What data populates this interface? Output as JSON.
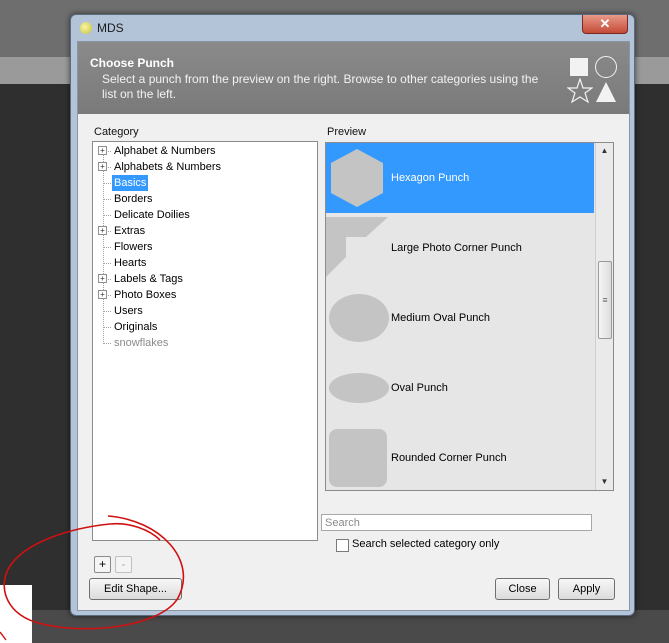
{
  "window": {
    "title": "MDS",
    "close_symbol": "✕"
  },
  "header": {
    "title": "Choose Punch",
    "description": "Select a punch from the preview on the right. Browse to other categories using the list on the left."
  },
  "category": {
    "label": "Category",
    "items": [
      {
        "label": "Alphabet & Numbers",
        "expandable": true
      },
      {
        "label": "Alphabets & Numbers",
        "expandable": true
      },
      {
        "label": "Basics",
        "expandable": false,
        "selected": true
      },
      {
        "label": "Borders",
        "expandable": false
      },
      {
        "label": "Delicate Doilies",
        "expandable": false
      },
      {
        "label": "Extras",
        "expandable": true
      },
      {
        "label": "Flowers",
        "expandable": false
      },
      {
        "label": "Hearts",
        "expandable": false
      },
      {
        "label": "Labels & Tags",
        "expandable": true
      },
      {
        "label": "Photo Boxes",
        "expandable": true
      },
      {
        "label": "Users",
        "expandable": false
      },
      {
        "label": "Originals",
        "expandable": false
      },
      {
        "label": "snowflakes",
        "expandable": false,
        "dim": true
      }
    ],
    "add_label": "+",
    "remove_label": "-",
    "expander_symbol": "+"
  },
  "preview": {
    "label": "Preview",
    "items": [
      {
        "label": "Hexagon Punch",
        "shape": "hexagon",
        "selected": true
      },
      {
        "label": "Large Photo Corner Punch",
        "shape": "photo-corner"
      },
      {
        "label": "Medium Oval Punch",
        "shape": "oval"
      },
      {
        "label": "Oval Punch",
        "shape": "oval-small"
      },
      {
        "label": "Rounded Corner Punch",
        "shape": "rounded-square"
      }
    ],
    "scroll_up": "▲",
    "scroll_down": "▼",
    "scroll_grip": "≡"
  },
  "search": {
    "placeholder": "Search",
    "value": "",
    "checkbox_label": "Search selected category only",
    "checked": false
  },
  "buttons": {
    "edit_shape": "Edit Shape...",
    "close": "Close",
    "apply": "Apply"
  },
  "colors": {
    "selection": "#3399ff",
    "annotation": "#d01010"
  }
}
